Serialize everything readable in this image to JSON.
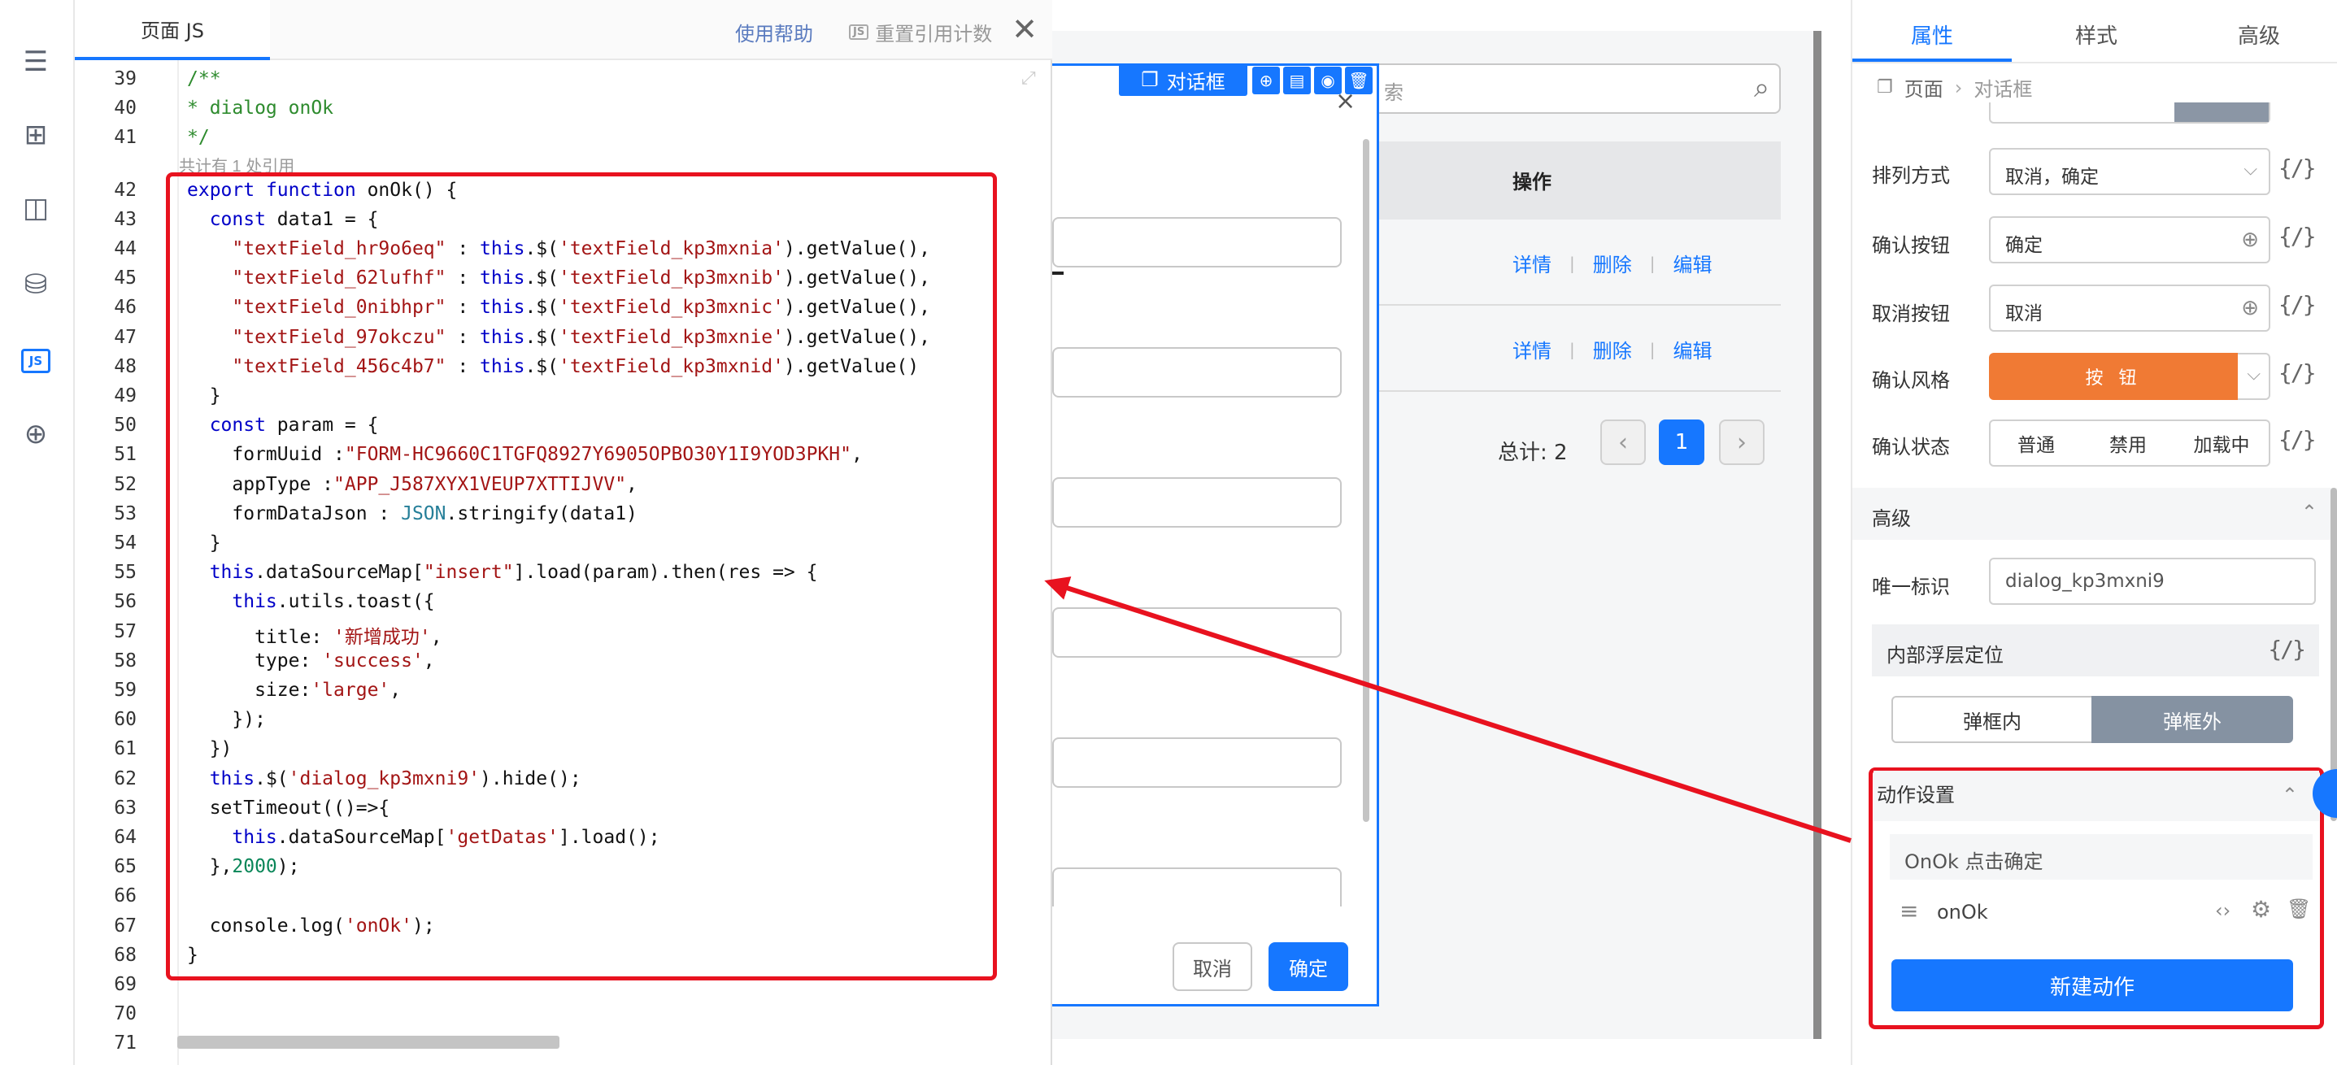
{
  "rail": {
    "icons": [
      "outline-icon",
      "components-icon",
      "layout-icon",
      "datasource-icon",
      "js-icon",
      "i18n-icon"
    ],
    "js_label": "JS"
  },
  "code_panel": {
    "tab_title": "页面 JS",
    "help": "使用帮助",
    "reset": "重置引用计数",
    "reset_badge": "JS",
    "close": "✕",
    "ref_note": "共计有 1 处引用",
    "lines": [
      {
        "n": "39",
        "html": "<span class='cm'>/**</span>"
      },
      {
        "n": "40",
        "html": "<span class='cm'>* dialog onOk</span>"
      },
      {
        "n": "41",
        "html": "<span class='cm'>*/</span>"
      },
      {
        "n": "42",
        "html": "<span class='kw'>export</span> <span class='kw'>function</span> onOk() {"
      },
      {
        "n": "43",
        "html": "  <span class='kw'>const</span> data1 = {"
      },
      {
        "n": "44",
        "html": "    <span class='str'>\"textField_hr9o6eq\"</span> : <span class='kw'>this</span>.$(<span class='str'>'textField_kp3mxnia'</span>).getValue(),"
      },
      {
        "n": "45",
        "html": "    <span class='str'>\"textField_62lufhf\"</span> : <span class='kw'>this</span>.$(<span class='str'>'textField_kp3mxnib'</span>).getValue(),"
      },
      {
        "n": "46",
        "html": "    <span class='str'>\"textField_0nibhpr\"</span> : <span class='kw'>this</span>.$(<span class='str'>'textField_kp3mxnic'</span>).getValue(),"
      },
      {
        "n": "47",
        "html": "    <span class='str'>\"textField_97okczu\"</span> : <span class='kw'>this</span>.$(<span class='str'>'textField_kp3mxnie'</span>).getValue(),"
      },
      {
        "n": "48",
        "html": "    <span class='str'>\"textField_456c4b7\"</span> : <span class='kw'>this</span>.$(<span class='str'>'textField_kp3mxnid'</span>).getValue()"
      },
      {
        "n": "49",
        "html": "  }"
      },
      {
        "n": "50",
        "html": "  <span class='kw'>const</span> param = {"
      },
      {
        "n": "51",
        "html": "    formUuid :<span class='str'>\"FORM-HC9660C1TGFQ8927Y6905OPBO30Y1I9YOD3PKH\"</span>,"
      },
      {
        "n": "52",
        "html": "    appType :<span class='str'>\"APP_J587XYX1VEUP7XTTIJVV\"</span>,"
      },
      {
        "n": "53",
        "html": "    formDataJson : <span class='typ'>JSON</span>.stringify(data1)"
      },
      {
        "n": "54",
        "html": "  }"
      },
      {
        "n": "55",
        "html": "  <span class='kw'>this</span>.dataSourceMap[<span class='str'>\"insert\"</span>].load(param).then(res => {"
      },
      {
        "n": "56",
        "html": "    <span class='kw'>this</span>.utils.toast({"
      },
      {
        "n": "57",
        "html": "      title: <span class='str'>'新增成功'</span>,"
      },
      {
        "n": "58",
        "html": "      type: <span class='str'>'success'</span>,"
      },
      {
        "n": "59",
        "html": "      size:<span class='str'>'large'</span>,"
      },
      {
        "n": "60",
        "html": "    });"
      },
      {
        "n": "61",
        "html": "  })"
      },
      {
        "n": "62",
        "html": "  <span class='kw'>this</span>.$(<span class='str'>'dialog_kp3mxni9'</span>).hide();"
      },
      {
        "n": "63",
        "html": "  setTimeout(()=>{"
      },
      {
        "n": "64",
        "html": "    <span class='kw'>this</span>.dataSourceMap[<span class='str'>'getDatas'</span>].load();"
      },
      {
        "n": "65",
        "html": "  },<span class='num'>2000</span>);"
      },
      {
        "n": "66",
        "html": ""
      },
      {
        "n": "67",
        "html": "  console.log(<span class='str'>'onOk'</span>);"
      },
      {
        "n": "68",
        "html": "}"
      },
      {
        "n": "69",
        "html": ""
      },
      {
        "n": "70",
        "html": ""
      },
      {
        "n": "71",
        "html": ""
      }
    ]
  },
  "canvas": {
    "search_placeholder": "索",
    "col_ops": "操作",
    "row_actions": [
      "详情",
      "删除",
      "编辑"
    ],
    "total": "总计: 2",
    "page_current": "1",
    "prev": "‹",
    "next": "›"
  },
  "dialog": {
    "label": "对话框",
    "cancel": "取消",
    "ok": "确定",
    "close": "×"
  },
  "right_panel": {
    "tabs": [
      "属性",
      "样式",
      "高级"
    ],
    "breadcrumb": [
      "页面",
      "对话框"
    ],
    "props": {
      "order_label": "排列方式",
      "order_value": "取消，确定",
      "ok_label": "确认按钮",
      "ok_value": "确定",
      "cancel_label": "取消按钮",
      "cancel_value": "取消",
      "style_label": "确认风格",
      "style_value": "按 钮",
      "state_label": "确认状态",
      "states": [
        "普通",
        "禁用",
        "加载中"
      ]
    },
    "bind_text": "{/}",
    "advanced": {
      "title": "高级",
      "id_label": "唯一标识",
      "id_value": "dialog_kp3mxni9",
      "pos_title": "内部浮层定位",
      "pos_options": [
        "弹框内",
        "弹框外"
      ],
      "pos_selected": "弹框外"
    },
    "actions": {
      "title": "动作设置",
      "event": "OnOk 点击确定",
      "handler": "onOk",
      "new_button": "新建动作"
    }
  },
  "colors": {
    "accent": "#1677ff",
    "highlight": "#e8121f",
    "orange": "#f07a34"
  }
}
